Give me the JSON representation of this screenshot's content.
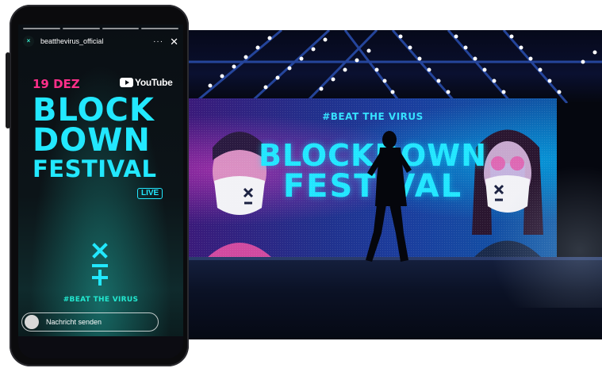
{
  "phone": {
    "story": {
      "username": "beatthevirus_official",
      "avatar_glyph": "×",
      "more_label": "···",
      "close_label": "✕",
      "date": "19 DEZ",
      "youtube": "YouTube",
      "title_line1": "BLOCK",
      "title_line2": "DOWN",
      "title_line3": "FESTIVAL",
      "live_badge": "LIVE",
      "hashtag": "#BEAT THE VIRUS",
      "message_placeholder": "Nachricht senden"
    }
  },
  "stage": {
    "hashtag": "#BEAT THE VIRUS",
    "title_line1": "BLOCKDOWN",
    "title_line2": "FESTIVAL"
  },
  "colors": {
    "accent_cyan": "#22e8ff",
    "accent_pink": "#ff2f8a",
    "teal": "#22e8d0"
  },
  "icons": [
    "logo-mark-icon",
    "youtube-play-icon",
    "close-icon",
    "more-icon"
  ]
}
